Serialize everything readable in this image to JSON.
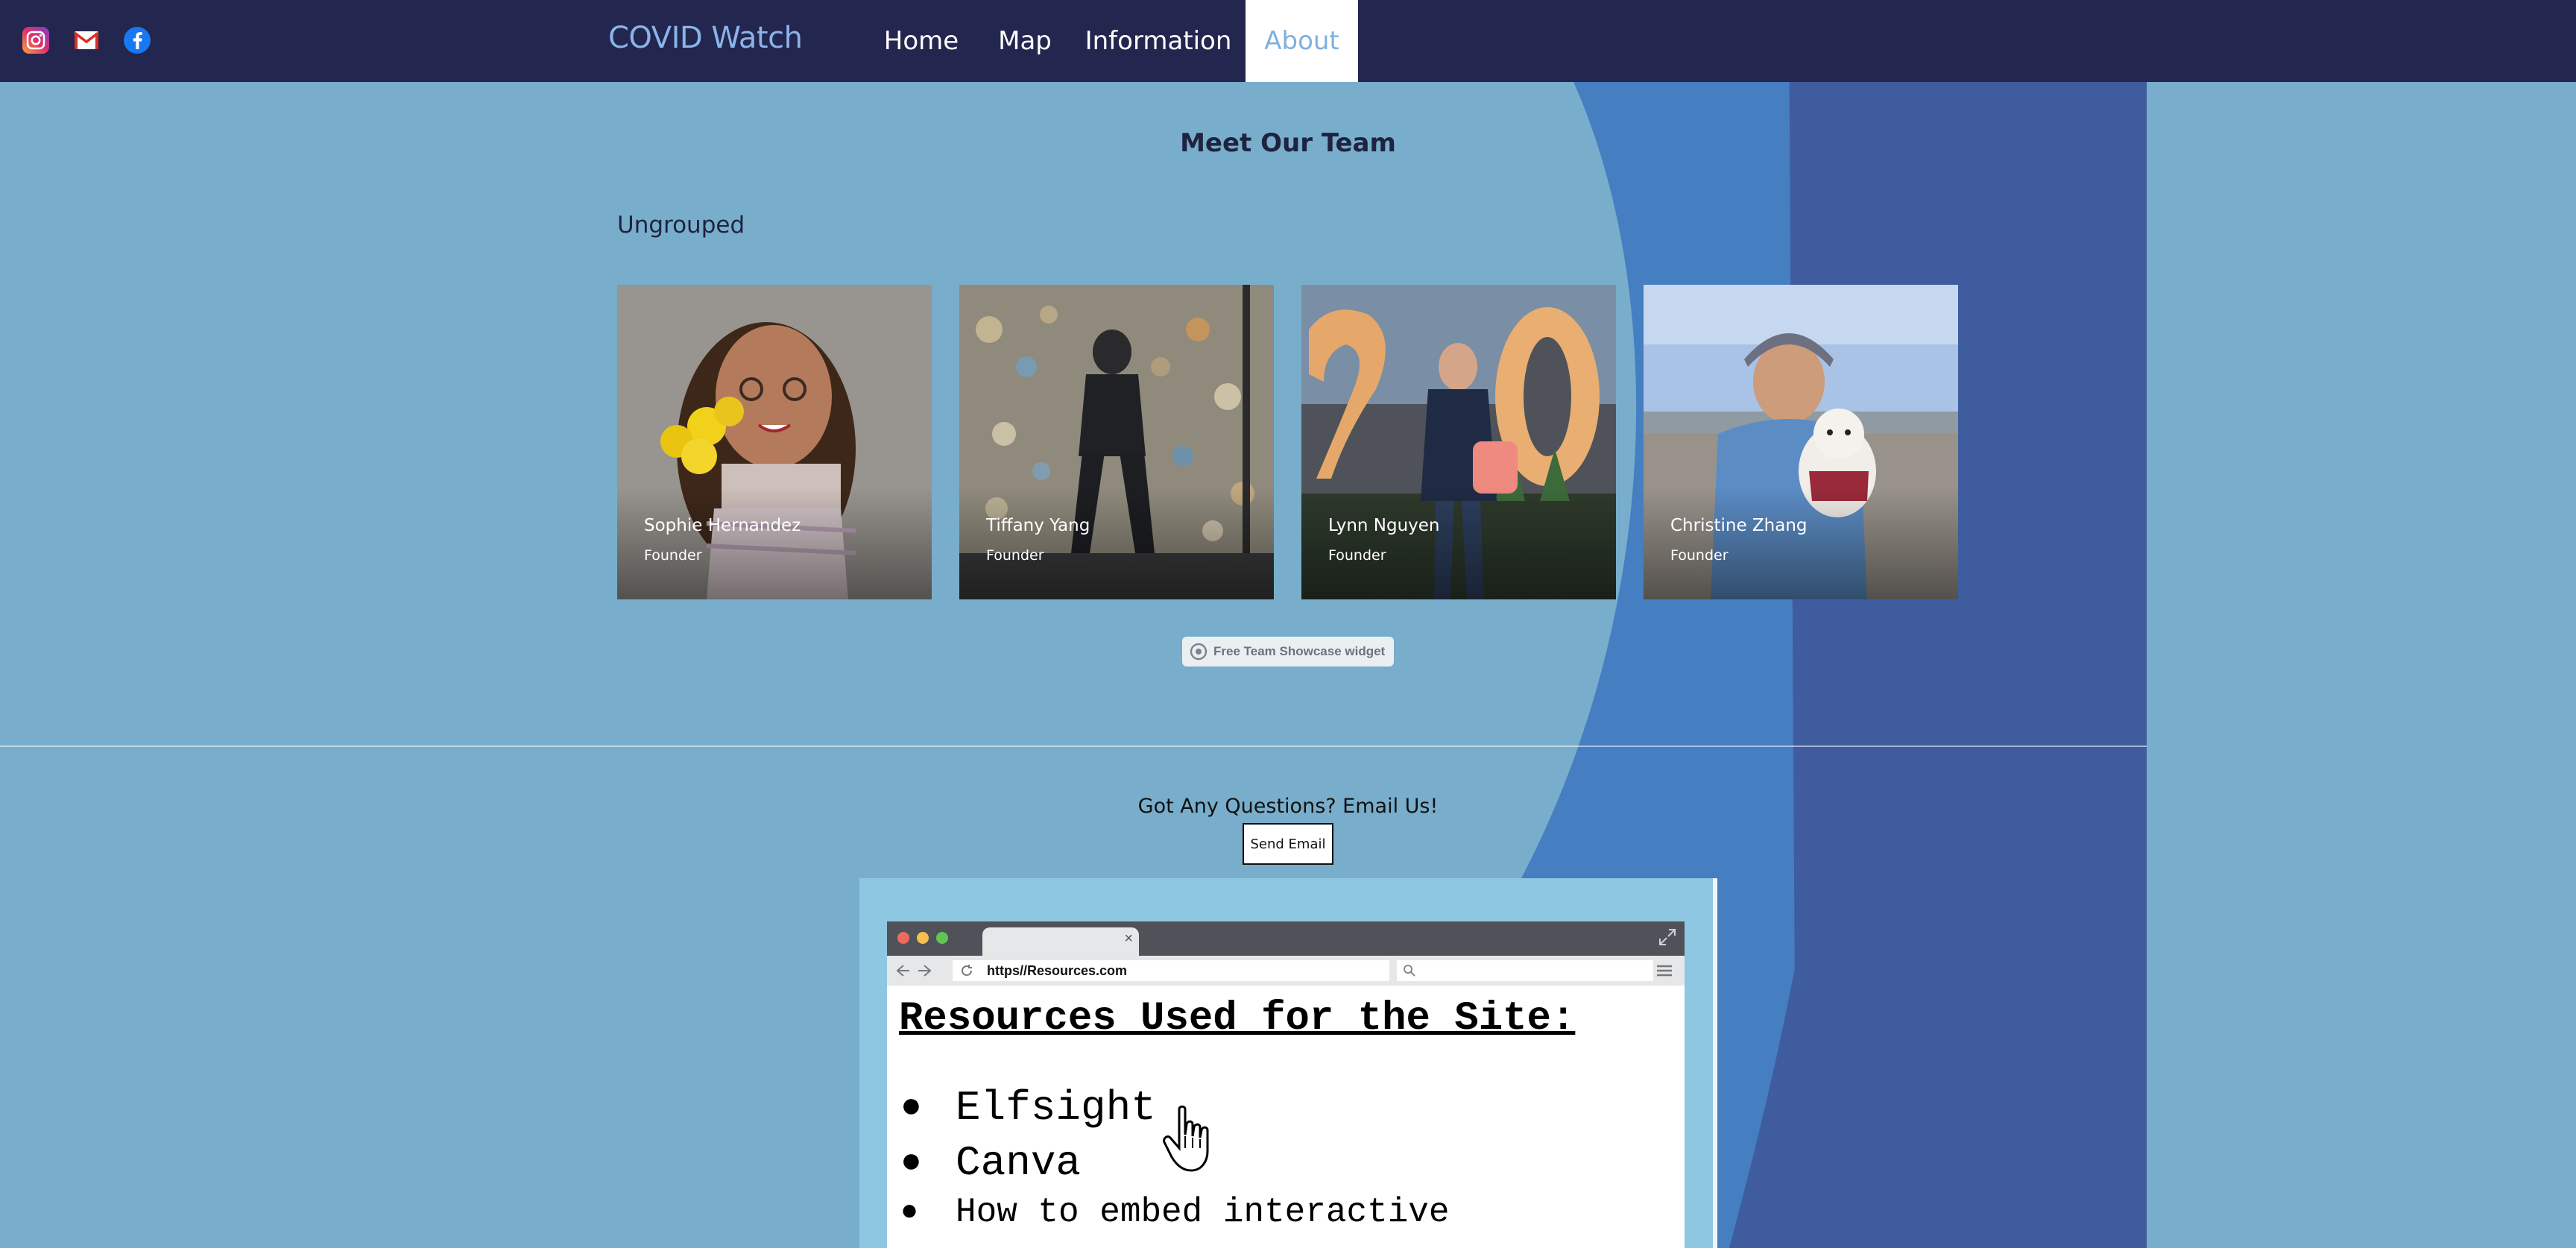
{
  "header": {
    "social": [
      {
        "name": "instagram-icon"
      },
      {
        "name": "gmail-icon"
      },
      {
        "name": "facebook-icon"
      }
    ],
    "brand": "COVID Watch",
    "nav": [
      {
        "label": "Home",
        "active": false
      },
      {
        "label": "Map",
        "active": false
      },
      {
        "label": "Information",
        "active": false
      },
      {
        "label": "About",
        "active": true
      }
    ]
  },
  "team": {
    "title": "Meet Our Team",
    "group": "Ungrouped",
    "members": [
      {
        "name": "Sophie Hernandez",
        "role": "Founder"
      },
      {
        "name": "Tiffany Yang",
        "role": "Founder"
      },
      {
        "name": "Lynn Nguyen",
        "role": "Founder"
      },
      {
        "name": "Christine Zhang",
        "role": "Founder"
      }
    ],
    "widget_badge": "Free Team Showcase widget"
  },
  "contact": {
    "heading": "Got Any Questions? Email Us!",
    "button": "Send Email"
  },
  "resources": {
    "url": "https//Resources.com",
    "title": "Resources Used for the Site:",
    "items": [
      "Elfsight",
      "Canva",
      "How to embed interactive"
    ]
  },
  "colors": {
    "nav_bg": "#23264e",
    "page_bg": "#78aecb",
    "brand": "#8ab4ea",
    "active_tab_text": "#7fb0de"
  }
}
